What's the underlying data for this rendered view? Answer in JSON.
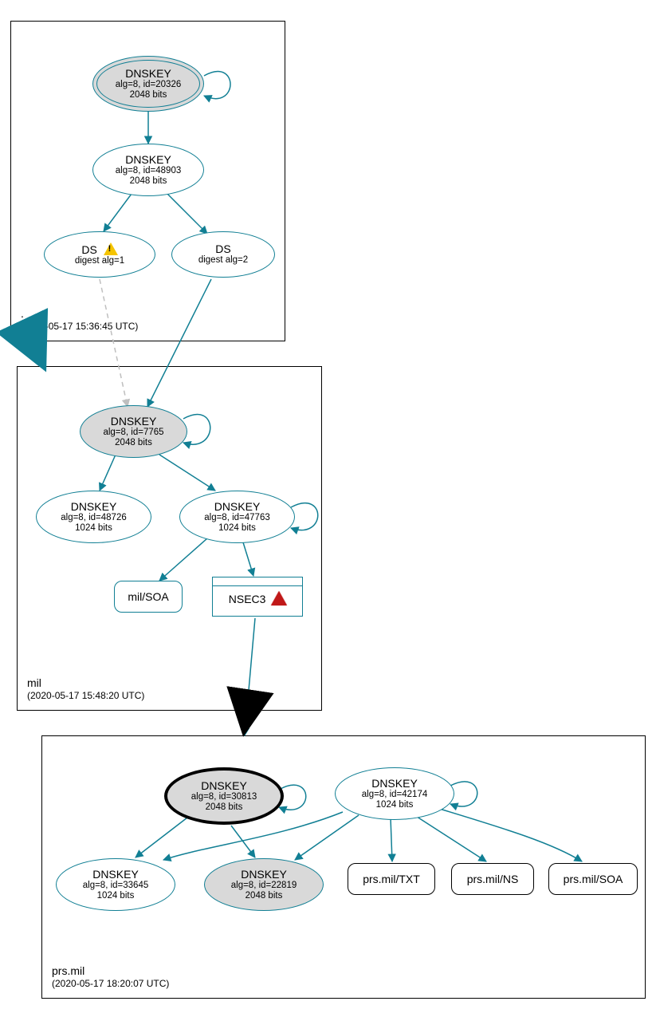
{
  "colors": {
    "teal": "#117f94",
    "grey": "#d9d9d9",
    "black": "#000000"
  },
  "zones": {
    "root": {
      "name": ".",
      "timestamp": "(2020-05-17 15:36:45 UTC)"
    },
    "mil": {
      "name": "mil",
      "timestamp": "(2020-05-17 15:48:20 UTC)"
    },
    "prs": {
      "name": "prs.mil",
      "timestamp": "(2020-05-17 18:20:07 UTC)"
    }
  },
  "nodes": {
    "root_ksk": {
      "title": "DNSKEY",
      "sub1": "alg=8, id=20326",
      "sub2": "2048 bits"
    },
    "root_zsk": {
      "title": "DNSKEY",
      "sub1": "alg=8, id=48903",
      "sub2": "2048 bits"
    },
    "ds1": {
      "title": "DS",
      "sub1": "digest alg=1"
    },
    "ds2": {
      "title": "DS",
      "sub1": "digest alg=2"
    },
    "mil_ksk": {
      "title": "DNSKEY",
      "sub1": "alg=8, id=7765",
      "sub2": "2048 bits"
    },
    "mil_zsk_a": {
      "title": "DNSKEY",
      "sub1": "alg=8, id=48726",
      "sub2": "1024 bits"
    },
    "mil_zsk_b": {
      "title": "DNSKEY",
      "sub1": "alg=8, id=47763",
      "sub2": "1024 bits"
    },
    "mil_soa": {
      "label": "mil/SOA"
    },
    "nsec3": {
      "label": "NSEC3"
    },
    "prs_ksk": {
      "title": "DNSKEY",
      "sub1": "alg=8, id=30813",
      "sub2": "2048 bits"
    },
    "prs_42174": {
      "title": "DNSKEY",
      "sub1": "alg=8, id=42174",
      "sub2": "1024 bits"
    },
    "prs_33645": {
      "title": "DNSKEY",
      "sub1": "alg=8, id=33645",
      "sub2": "1024 bits"
    },
    "prs_22819": {
      "title": "DNSKEY",
      "sub1": "alg=8, id=22819",
      "sub2": "2048 bits"
    },
    "prs_txt": {
      "label": "prs.mil/TXT"
    },
    "prs_ns": {
      "label": "prs.mil/NS"
    },
    "prs_soa": {
      "label": "prs.mil/SOA"
    }
  }
}
